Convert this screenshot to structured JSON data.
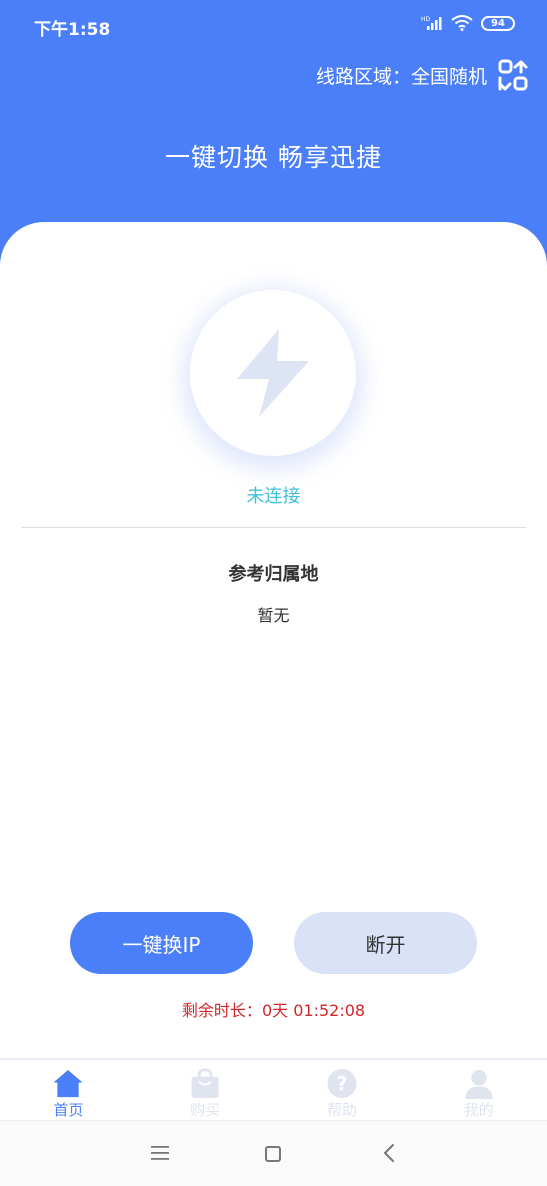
{
  "status_bar": {
    "time": "下午1:58",
    "battery": "94"
  },
  "header": {
    "region_label": "线路区域：",
    "region_value": "全国随机",
    "slogan": "一键切换 畅享迅捷"
  },
  "connection": {
    "status": "未连接",
    "location_title": "参考归属地",
    "location_value": "暂无"
  },
  "actions": {
    "switch_ip_label": "一键换IP",
    "disconnect_label": "断开"
  },
  "remaining": {
    "label": "剩余时长：",
    "value": "0天 01:52:08"
  },
  "tabs": [
    {
      "label": "首页",
      "icon": "home-icon",
      "active": true
    },
    {
      "label": "购买",
      "icon": "shopping-bag-icon",
      "active": false
    },
    {
      "label": "帮助",
      "icon": "help-icon",
      "active": false
    },
    {
      "label": "我的",
      "icon": "user-icon",
      "active": false
    }
  ],
  "colors": {
    "brand": "#4a7ff9",
    "status_text": "#3fc2d9",
    "remaining_text": "#d3262b",
    "secondary_button": "#d9e2f7",
    "inactive_tab": "#dfe4ee"
  }
}
